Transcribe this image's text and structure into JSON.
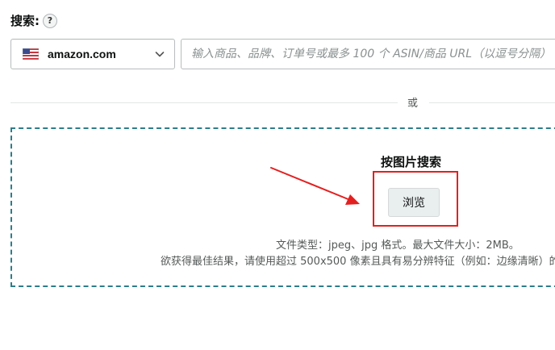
{
  "search": {
    "label": "搜索:",
    "help_icon_glyph": "?",
    "marketplace": "amazon.com",
    "marketplace_flag_icon": "us-flag-icon",
    "placeholder": "输入商品、品牌、订单号或最多 100 个 ASIN/商品 URL（以逗号分隔）"
  },
  "divider": {
    "or_text": "或"
  },
  "image_search": {
    "title": "按图片搜索",
    "browse_label": "浏览",
    "file_info": "文件类型：jpeg、jpg 格式。最大文件大小：2MB。",
    "best_result_tip": "欲获得最佳结果，请使用超过 500x500 像素且具有易分辨特征（例如：边缘清晰）的图片。"
  },
  "colors": {
    "dashed_border": "#2d7d8a",
    "annotation_red": "#e32020"
  }
}
